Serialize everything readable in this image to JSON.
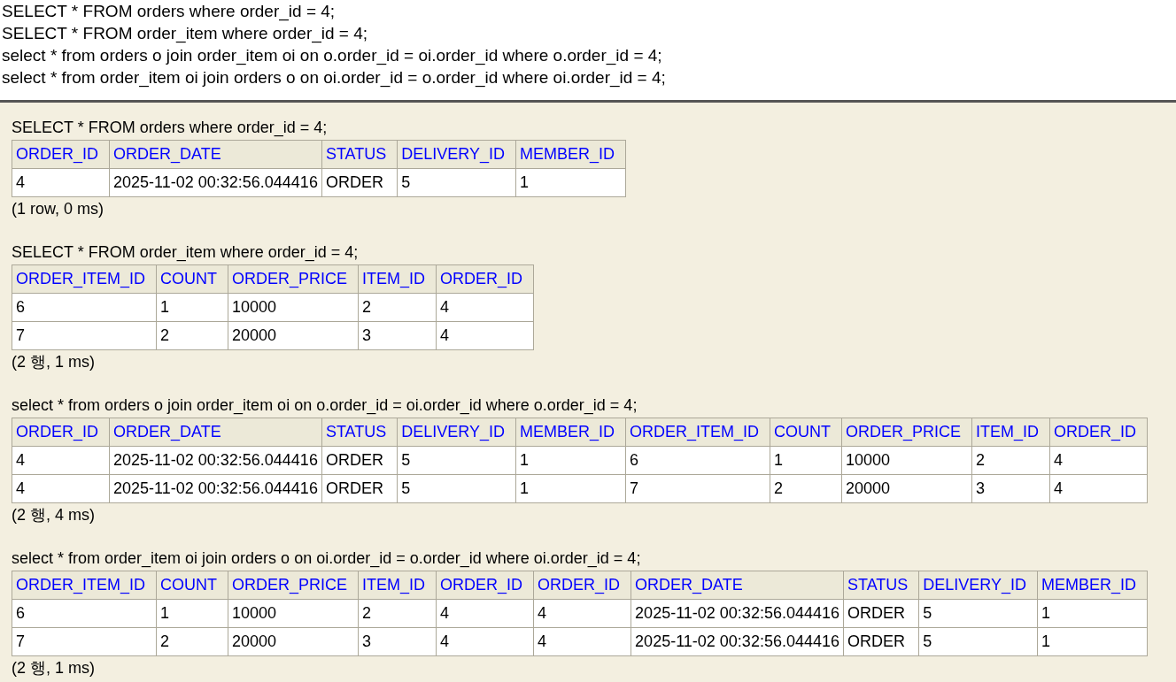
{
  "sql_editor": {
    "lines": [
      "SELECT * FROM orders where order_id = 4;",
      "SELECT * FROM order_item where order_id = 4;",
      "select * from orders o join order_item oi on o.order_id = oi.order_id where o.order_id = 4;",
      "select * from order_item oi join orders o on oi.order_id = o.order_id where oi.order_id = 4;"
    ]
  },
  "results": [
    {
      "query": "SELECT * FROM orders where order_id = 4;",
      "columns": [
        "ORDER_ID",
        "ORDER_DATE",
        "STATUS",
        "DELIVERY_ID",
        "MEMBER_ID"
      ],
      "rows": [
        [
          "4",
          "2025-11-02 00:32:56.044416",
          "ORDER",
          "5",
          "1"
        ]
      ],
      "summary": "(1 row, 0 ms)"
    },
    {
      "query": "SELECT * FROM order_item where order_id = 4;",
      "columns": [
        "ORDER_ITEM_ID",
        "COUNT",
        "ORDER_PRICE",
        "ITEM_ID",
        "ORDER_ID"
      ],
      "rows": [
        [
          "6",
          "1",
          "10000",
          "2",
          "4"
        ],
        [
          "7",
          "2",
          "20000",
          "3",
          "4"
        ]
      ],
      "summary": "(2 행, 1 ms)"
    },
    {
      "query": "select * from orders o join order_item oi on o.order_id = oi.order_id where o.order_id = 4;",
      "columns": [
        "ORDER_ID",
        "ORDER_DATE",
        "STATUS",
        "DELIVERY_ID",
        "MEMBER_ID",
        "ORDER_ITEM_ID",
        "COUNT",
        "ORDER_PRICE",
        "ITEM_ID",
        "ORDER_ID"
      ],
      "rows": [
        [
          "4",
          "2025-11-02 00:32:56.044416",
          "ORDER",
          "5",
          "1",
          "6",
          "1",
          "10000",
          "2",
          "4"
        ],
        [
          "4",
          "2025-11-02 00:32:56.044416",
          "ORDER",
          "5",
          "1",
          "7",
          "2",
          "20000",
          "3",
          "4"
        ]
      ],
      "summary": "(2 행, 4 ms)"
    },
    {
      "query": "select * from order_item oi join orders o on oi.order_id = o.order_id where oi.order_id = 4;",
      "columns": [
        "ORDER_ITEM_ID",
        "COUNT",
        "ORDER_PRICE",
        "ITEM_ID",
        "ORDER_ID",
        "ORDER_ID",
        "ORDER_DATE",
        "STATUS",
        "DELIVERY_ID",
        "MEMBER_ID"
      ],
      "rows": [
        [
          "6",
          "1",
          "10000",
          "2",
          "4",
          "4",
          "2025-11-02 00:32:56.044416",
          "ORDER",
          "5",
          "1"
        ],
        [
          "7",
          "2",
          "20000",
          "3",
          "4",
          "4",
          "2025-11-02 00:32:56.044416",
          "ORDER",
          "5",
          "1"
        ]
      ],
      "summary": "(2 행, 1 ms)"
    }
  ]
}
